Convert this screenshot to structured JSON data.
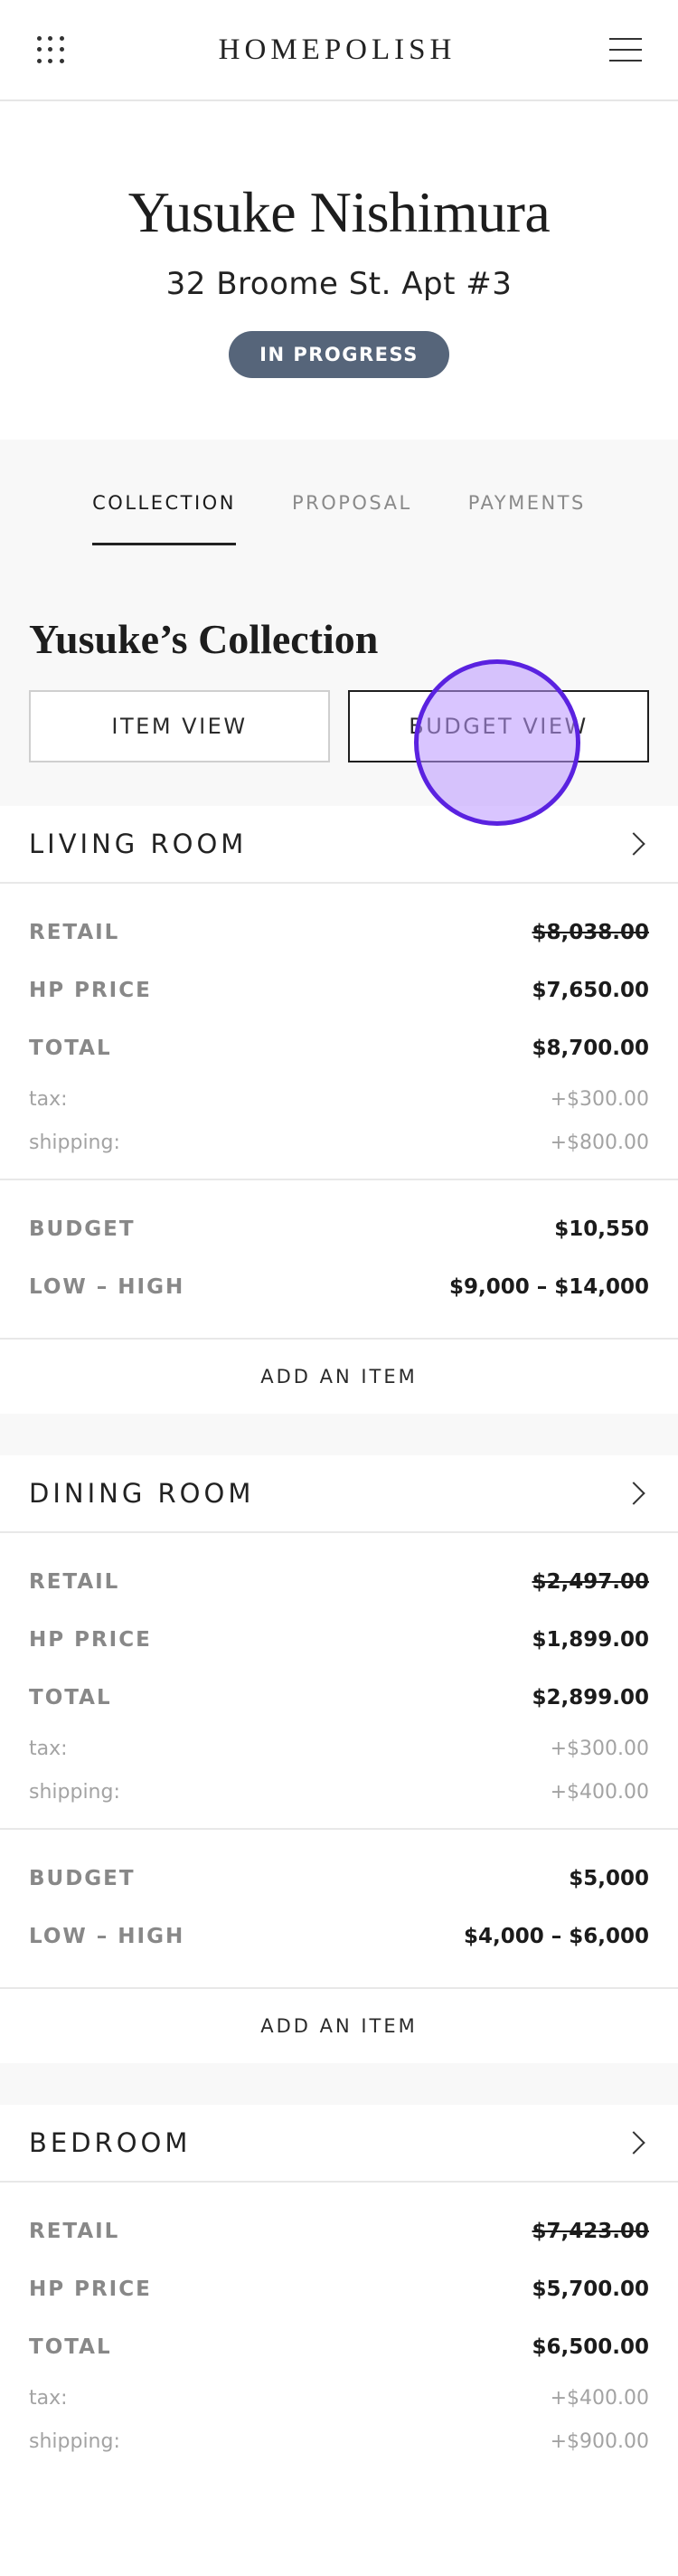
{
  "header": {
    "brand": "HOMEPOLISH",
    "apps_icon": "grid-dots-icon",
    "menu_icon": "hamburger-menu-icon"
  },
  "client": {
    "name": "Yusuke Nishimura",
    "address": "32 Broome St. Apt #3",
    "status": "IN PROGRESS",
    "status_color": "#56657a"
  },
  "tabs": [
    {
      "label": "COLLECTION",
      "active": true
    },
    {
      "label": "PROPOSAL",
      "active": false
    },
    {
      "label": "PAYMENTS",
      "active": false
    }
  ],
  "collection": {
    "title": "Yusuke’s Collection",
    "item_view_label": "ITEM VIEW",
    "budget_view_label": "BUDGET VIEW",
    "selected_view": "budget"
  },
  "labels": {
    "retail": "RETAIL",
    "hp_price": "HP PRICE",
    "total": "TOTAL",
    "tax": "tax:",
    "shipping": "shipping:",
    "budget": "BUDGET",
    "low_high": "LOW – HIGH",
    "add_item": "ADD AN ITEM"
  },
  "rooms": [
    {
      "name": "LIVING ROOM",
      "retail": "$8,038.00",
      "hp_price": "$7,650.00",
      "total": "$8,700.00",
      "tax": "+$300.00",
      "shipping": "+$800.00",
      "budget": "$10,550",
      "low_high": "$9,000 – $14,000"
    },
    {
      "name": "DINING ROOM",
      "retail": "$2,497.00",
      "hp_price": "$1,899.00",
      "total": "$2,899.00",
      "tax": "+$300.00",
      "shipping": "+$400.00",
      "budget": "$5,000",
      "low_high": "$4,000 – $6,000"
    },
    {
      "name": "BEDROOM",
      "retail": "$7,423.00",
      "hp_price": "$5,700.00",
      "total": "$6,500.00",
      "tax": "+$400.00",
      "shipping": "+$900.00",
      "budget": "",
      "low_high": ""
    }
  ],
  "colors": {
    "accent_tap": "#5a22e0",
    "muted_text": "#888888"
  }
}
